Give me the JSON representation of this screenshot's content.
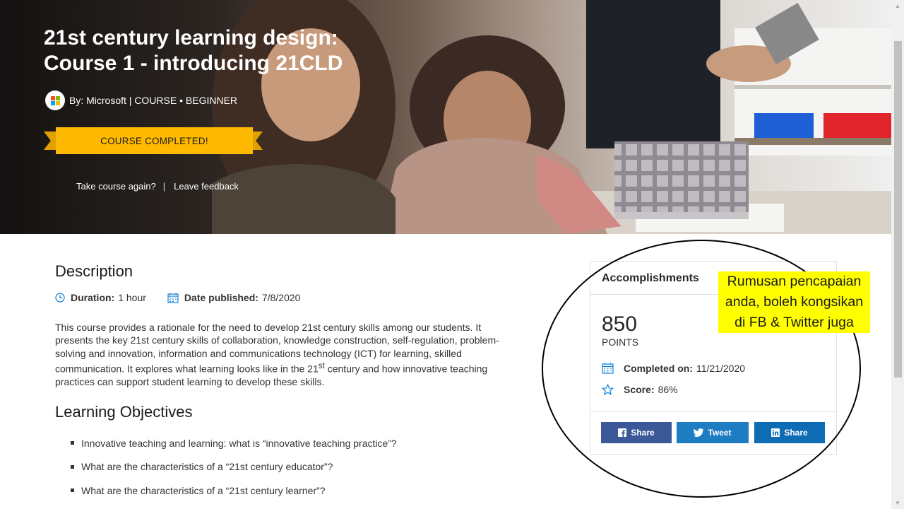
{
  "hero": {
    "title_line1": "21st century learning design:",
    "title_line2": "Course 1 - introducing 21CLD",
    "byline": "By: Microsoft | COURSE • BEGINNER",
    "banner": "COURSE COMPLETED!",
    "link_retake": "Take course again?",
    "separator": "|",
    "link_feedback": "Leave feedback"
  },
  "description": {
    "heading": "Description",
    "duration_label": "Duration:",
    "duration_value": "1 hour",
    "published_label": "Date published:",
    "published_value": "7/8/2020",
    "body_part1": "This course provides a rationale for the need to develop 21st century skills among our students. It presents the key 21st century skills of collaboration, knowledge construction, self-regulation, problem-solving and innovation, information and communications technology (ICT) for learning, skilled communication. It explores what learning looks like in the 21",
    "body_sup": "st",
    "body_part2": " century and how innovative teaching practices can support student learning to develop these skills."
  },
  "objectives": {
    "heading": "Learning Objectives",
    "items": [
      "Innovative teaching and learning: what is “innovative teaching practice”?",
      "What are the characteristics of a “21st century educator”?",
      "What are the characteristics of a “21st century learner”?"
    ]
  },
  "accomplishments": {
    "heading": "Accomplishments",
    "points": "850",
    "points_label": "POINTS",
    "completed_label": "Completed on:",
    "completed_value": "11/21/2020",
    "score_label": "Score:",
    "score_value": "86%",
    "share_facebook": "Share",
    "share_twitter": "Tweet",
    "share_linkedin": "Share"
  },
  "annotation": {
    "note": "Rumusan pencapaian anda, boleh kongsikan di FB & Twitter juga"
  },
  "colors": {
    "banner": "#ffb900",
    "facebook": "#3b5998",
    "twitter": "#1d7cc2",
    "linkedin": "#0e6cb5",
    "icon_blue": "#0078d4",
    "highlight": "#ffff00"
  },
  "icons": [
    "microsoft-logo-icon",
    "clock-icon",
    "calendar-icon",
    "star-icon",
    "facebook-icon",
    "twitter-icon",
    "linkedin-icon"
  ]
}
